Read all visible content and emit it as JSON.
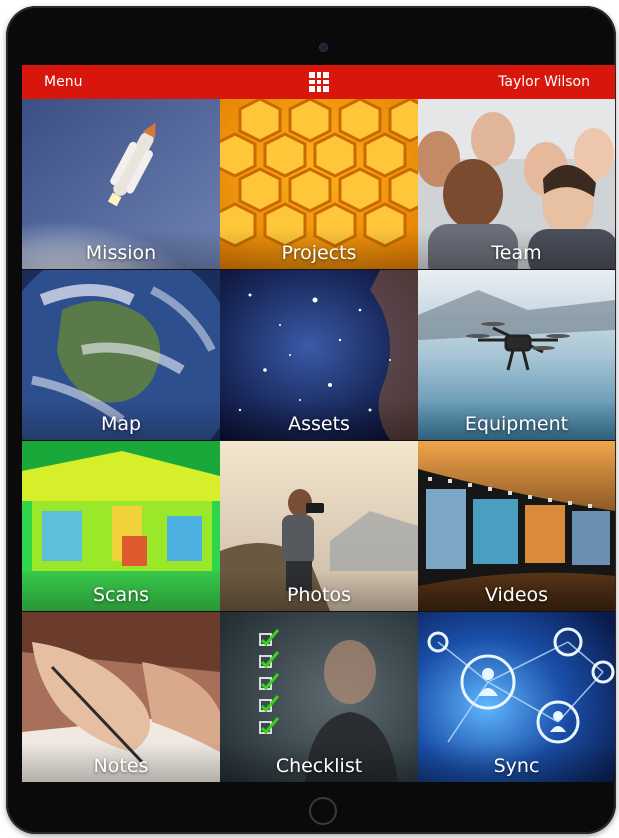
{
  "header": {
    "menu_label": "Menu",
    "user_name": "Taylor Wilson",
    "grid_icon": "grid-icon",
    "bar_color": "#d9160b"
  },
  "tiles": [
    {
      "label": "Mission",
      "icon": "rocket-launch-image"
    },
    {
      "label": "Projects",
      "icon": "honeycomb-image"
    },
    {
      "label": "Team",
      "icon": "team-photo-image"
    },
    {
      "label": "Map",
      "icon": "earth-globe-image"
    },
    {
      "label": "Assets",
      "icon": "starfield-image"
    },
    {
      "label": "Equipment",
      "icon": "drone-image"
    },
    {
      "label": "Scans",
      "icon": "thermal-scan-image"
    },
    {
      "label": "Photos",
      "icon": "photographer-image"
    },
    {
      "label": "Videos",
      "icon": "film-strip-image"
    },
    {
      "label": "Notes",
      "icon": "handwriting-image"
    },
    {
      "label": "Checklist",
      "icon": "checklist-image"
    },
    {
      "label": "Sync",
      "icon": "network-sync-image"
    }
  ]
}
